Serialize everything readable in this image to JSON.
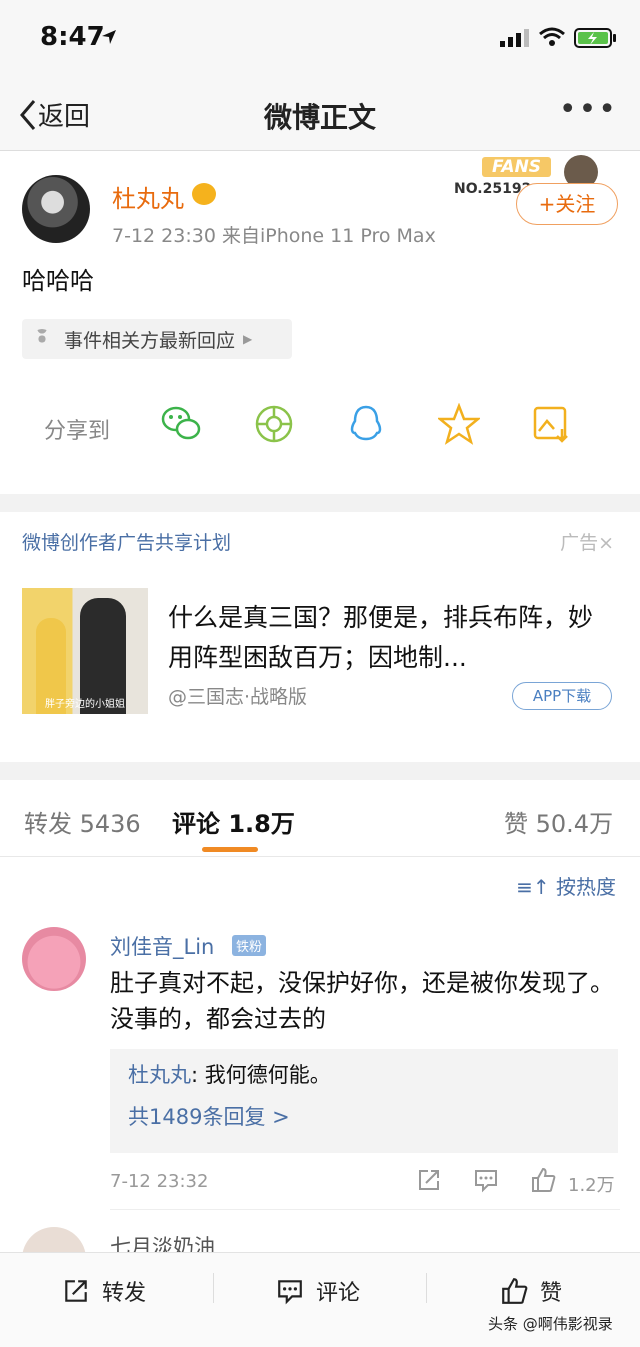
{
  "status": {
    "time": "8:47"
  },
  "nav": {
    "back_label": "返回",
    "title": "微博正文"
  },
  "post": {
    "username": "杜丸丸",
    "meta": "7-12 23:30  来自iPhone 11 Pro Max",
    "fans_label": "FANS",
    "fans_no": "NO.25192",
    "follow_label": "+关注",
    "content": "哈哈哈",
    "event_label": "事件相关方最新回应",
    "share_label": "分享到"
  },
  "ad": {
    "title": "微博创作者广告共享计划",
    "tag": "广告×",
    "text": "什么是真三国？那便是，排兵布阵，妙用阵型困敌百万；因地制...",
    "source": "@三国志·战略版",
    "button": "APP下载",
    "image_caption": "胖子旁边的小姐姐"
  },
  "tabs": {
    "repost": "转发 5436",
    "comment": "评论 1.8万",
    "like": "赞 50.4万"
  },
  "comments": {
    "sort_label": "按热度",
    "items": [
      {
        "name": "刘佳音_Lin",
        "badge": "铁粉",
        "text": "肚子真对不起，没保护好你，还是被你发现了。没事的，都会过去的",
        "reply_name": "杜丸丸",
        "reply_text": ": 我何德何能。",
        "reply_more": "共1489条回复 >",
        "time": "7-12 23:32",
        "likes": "1.2万"
      },
      {
        "name": "七月淡奶油"
      }
    ]
  },
  "bottom": {
    "repost": "转发",
    "comment": "评论",
    "like": "赞",
    "watermark": "头条 @啊伟影视录"
  },
  "colors": {
    "accent": "#e86b0e",
    "link": "#4a6fa5",
    "underline": "#f08a24"
  }
}
